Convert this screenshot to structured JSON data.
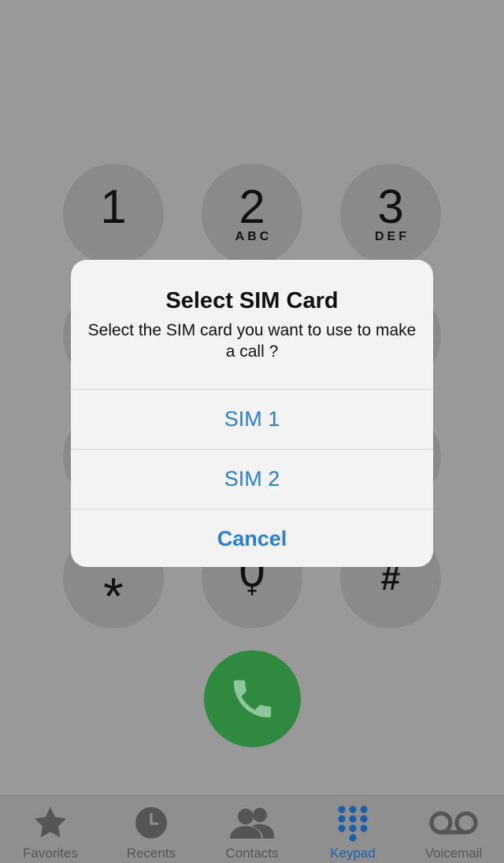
{
  "keypad": {
    "keys": [
      {
        "digit": "1",
        "letters": ""
      },
      {
        "digit": "2",
        "letters": "ABC"
      },
      {
        "digit": "3",
        "letters": "DEF"
      }
    ],
    "star": "*",
    "zero": "0",
    "zero_sub": "+",
    "hash": "#"
  },
  "call_button": {
    "icon": "phone-icon",
    "color": "#2f8a3f"
  },
  "alert": {
    "title": "Select SIM Card",
    "message": "Select the SIM card you want to use to make a call ?",
    "actions": [
      {
        "label": "SIM 1"
      },
      {
        "label": "SIM 2"
      },
      {
        "label": "Cancel"
      }
    ],
    "action_color": "#2a7fd0"
  },
  "tabbar": {
    "tabs": [
      {
        "label": "Favorites",
        "icon": "star-icon"
      },
      {
        "label": "Recents",
        "icon": "clock-icon"
      },
      {
        "label": "Contacts",
        "icon": "contacts-icon"
      },
      {
        "label": "Keypad",
        "icon": "keypad-icon",
        "active": true
      },
      {
        "label": "Voicemail",
        "icon": "voicemail-icon"
      }
    ],
    "active_color": "#1a5fa8"
  }
}
